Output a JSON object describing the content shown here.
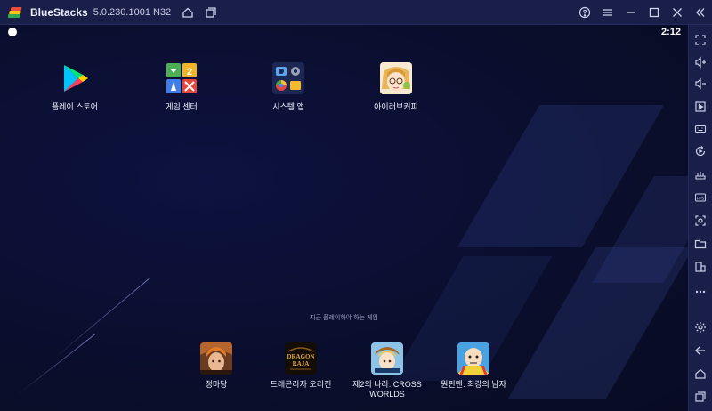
{
  "titlebar": {
    "app_name": "BlueStacks",
    "version": "5.0.230.1001 N32"
  },
  "statusbar": {
    "time": "2:12"
  },
  "home_apps": [
    {
      "label": "플레이 스토어",
      "icon": "play-store-icon"
    },
    {
      "label": "게임 센터",
      "icon": "game-center-icon"
    },
    {
      "label": "시스템 앱",
      "icon": "system-apps-icon"
    },
    {
      "label": "아이러브커피",
      "icon": "i-love-coffee-icon"
    }
  ],
  "recent_section_title": "지금 플레이하야 하는 게임",
  "games": [
    {
      "label": "정마당",
      "icon": "jeongmadang-icon"
    },
    {
      "label": "드래곤라자 오리진",
      "icon": "dragon-raja-icon"
    },
    {
      "label": "제2의 나라: CROSS WORLDS",
      "icon": "ni-no-kuni-icon"
    },
    {
      "label": "원펀맨: 최강의 남자",
      "icon": "one-punch-man-icon"
    }
  ],
  "sidebar_icons": [
    "fullscreen-icon",
    "volume-up-icon",
    "volume-down-icon",
    "media-icon",
    "keyboard-icon",
    "rotate-icon",
    "macro-icon",
    "fps-icon",
    "screenshot-icon",
    "folder-icon",
    "multi-instance-icon",
    "more-icon",
    "settings-icon",
    "back-icon",
    "home-icon",
    "recent-apps-icon"
  ],
  "colors": {
    "titlebar": "#1a1f4a",
    "screen": "#0b0f2e",
    "accent": "#3b82f6"
  }
}
